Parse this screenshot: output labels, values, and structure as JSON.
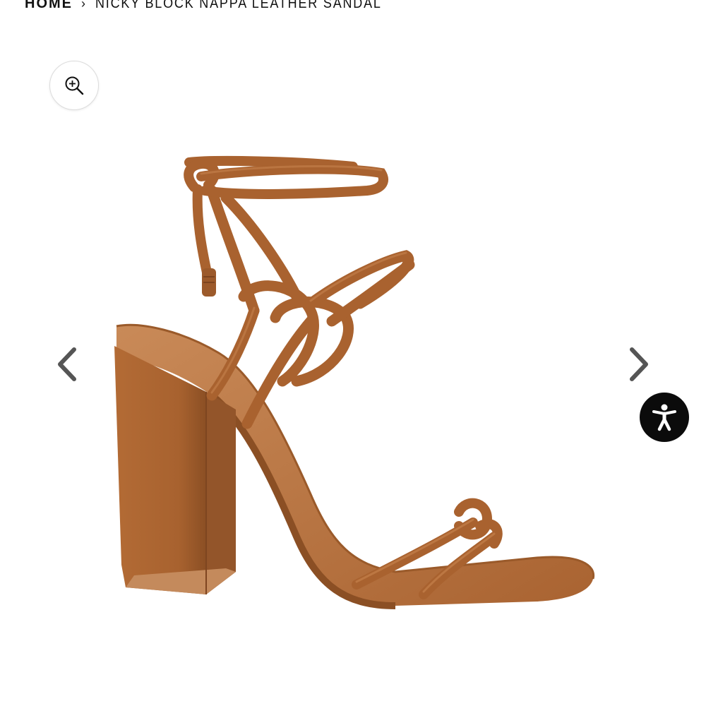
{
  "breadcrumb": {
    "home_label": "HOME",
    "separator": "›",
    "current_label": "NICKY BLOCK NAPPA LEATHER SANDAL"
  },
  "gallery": {
    "zoom_icon": "zoom-in-icon",
    "prev_icon": "chevron-left-icon",
    "next_icon": "chevron-right-icon",
    "image_alt": "Nicky Block Nappa Leather Sandal"
  },
  "accessibility": {
    "icon": "accessibility-person-icon",
    "background_color": "#0b0b0b"
  },
  "colors": {
    "leather": "#b06a34",
    "leather_dark": "#8a4e22",
    "leather_light": "#c98550",
    "text": "#111111",
    "arrow": "#555555"
  }
}
